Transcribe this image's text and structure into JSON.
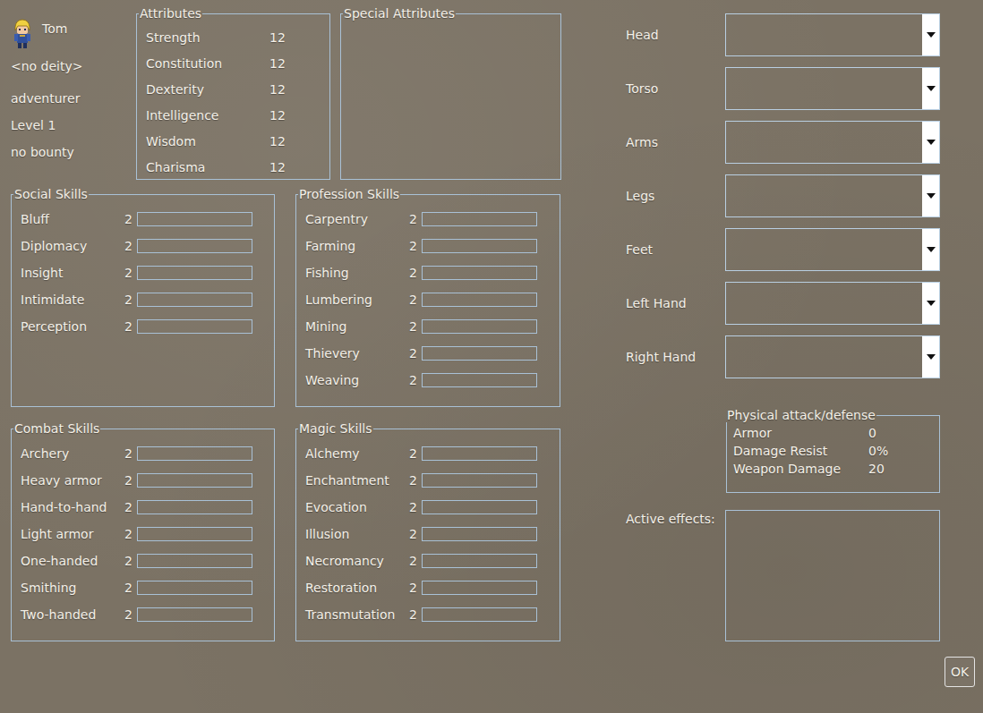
{
  "character": {
    "name": "Tom",
    "deity": "<no deity>",
    "class": "adventurer",
    "level": "Level 1",
    "bounty": "no bounty"
  },
  "attributes": {
    "title": "Attributes",
    "items": [
      {
        "name": "Strength",
        "value": "12"
      },
      {
        "name": "Constitution",
        "value": "12"
      },
      {
        "name": "Dexterity",
        "value": "12"
      },
      {
        "name": "Intelligence",
        "value": "12"
      },
      {
        "name": "Wisdom",
        "value": "12"
      },
      {
        "name": "Charisma",
        "value": "12"
      }
    ]
  },
  "special_attributes": {
    "title": "Special Attributes",
    "items": []
  },
  "skill_groups": [
    {
      "title": "Social Skills",
      "skills": [
        {
          "name": "Bluff",
          "value": "2",
          "level": 0
        },
        {
          "name": "Diplomacy",
          "value": "2",
          "level": 0
        },
        {
          "name": "Insight",
          "value": "2",
          "level": 0
        },
        {
          "name": "Intimidate",
          "value": "2",
          "level": 0
        },
        {
          "name": "Perception",
          "value": "2",
          "level": 0
        }
      ]
    },
    {
      "title": "Profession Skills",
      "skills": [
        {
          "name": "Carpentry",
          "value": "2",
          "level": 0
        },
        {
          "name": "Farming",
          "value": "2",
          "level": 0
        },
        {
          "name": "Fishing",
          "value": "2",
          "level": 0
        },
        {
          "name": "Lumbering",
          "value": "2",
          "level": 0
        },
        {
          "name": "Mining",
          "value": "2",
          "level": 0
        },
        {
          "name": "Thievery",
          "value": "2",
          "level": 0
        },
        {
          "name": "Weaving",
          "value": "2",
          "level": 0
        }
      ]
    },
    {
      "title": "Combat Skills",
      "skills": [
        {
          "name": "Archery",
          "value": "2",
          "level": 0
        },
        {
          "name": "Heavy armor",
          "value": "2",
          "level": 0
        },
        {
          "name": "Hand-to-hand",
          "value": "2",
          "level": 0
        },
        {
          "name": "Light armor",
          "value": "2",
          "level": 0
        },
        {
          "name": "One-handed",
          "value": "2",
          "level": 0
        },
        {
          "name": "Smithing",
          "value": "2",
          "level": 0
        },
        {
          "name": "Two-handed",
          "value": "2",
          "level": 0
        }
      ]
    },
    {
      "title": "Magic Skills",
      "skills": [
        {
          "name": "Alchemy",
          "value": "2",
          "level": 0
        },
        {
          "name": "Enchantment",
          "value": "2",
          "level": 0
        },
        {
          "name": "Evocation",
          "value": "2",
          "level": 0
        },
        {
          "name": "Illusion",
          "value": "2",
          "level": 0
        },
        {
          "name": "Necromancy",
          "value": "2",
          "level": 0
        },
        {
          "name": "Restoration",
          "value": "2",
          "level": 0
        },
        {
          "name": "Transmutation",
          "value": "2",
          "level": 0
        }
      ]
    }
  ],
  "equipment": [
    {
      "slot": "Head",
      "value": ""
    },
    {
      "slot": "Torso",
      "value": ""
    },
    {
      "slot": "Arms",
      "value": ""
    },
    {
      "slot": "Legs",
      "value": ""
    },
    {
      "slot": "Feet",
      "value": ""
    },
    {
      "slot": "Left Hand",
      "value": ""
    },
    {
      "slot": "Right Hand",
      "value": ""
    }
  ],
  "physical": {
    "title": "Physical attack/defense",
    "stats": [
      {
        "name": "Armor",
        "value": "0"
      },
      {
        "name": "Damage Resist",
        "value": "0%"
      },
      {
        "name": "Weapon Damage",
        "value": "20"
      }
    ]
  },
  "active_effects": {
    "label": "Active effects:",
    "items": []
  },
  "buttons": [
    "OK"
  ]
}
